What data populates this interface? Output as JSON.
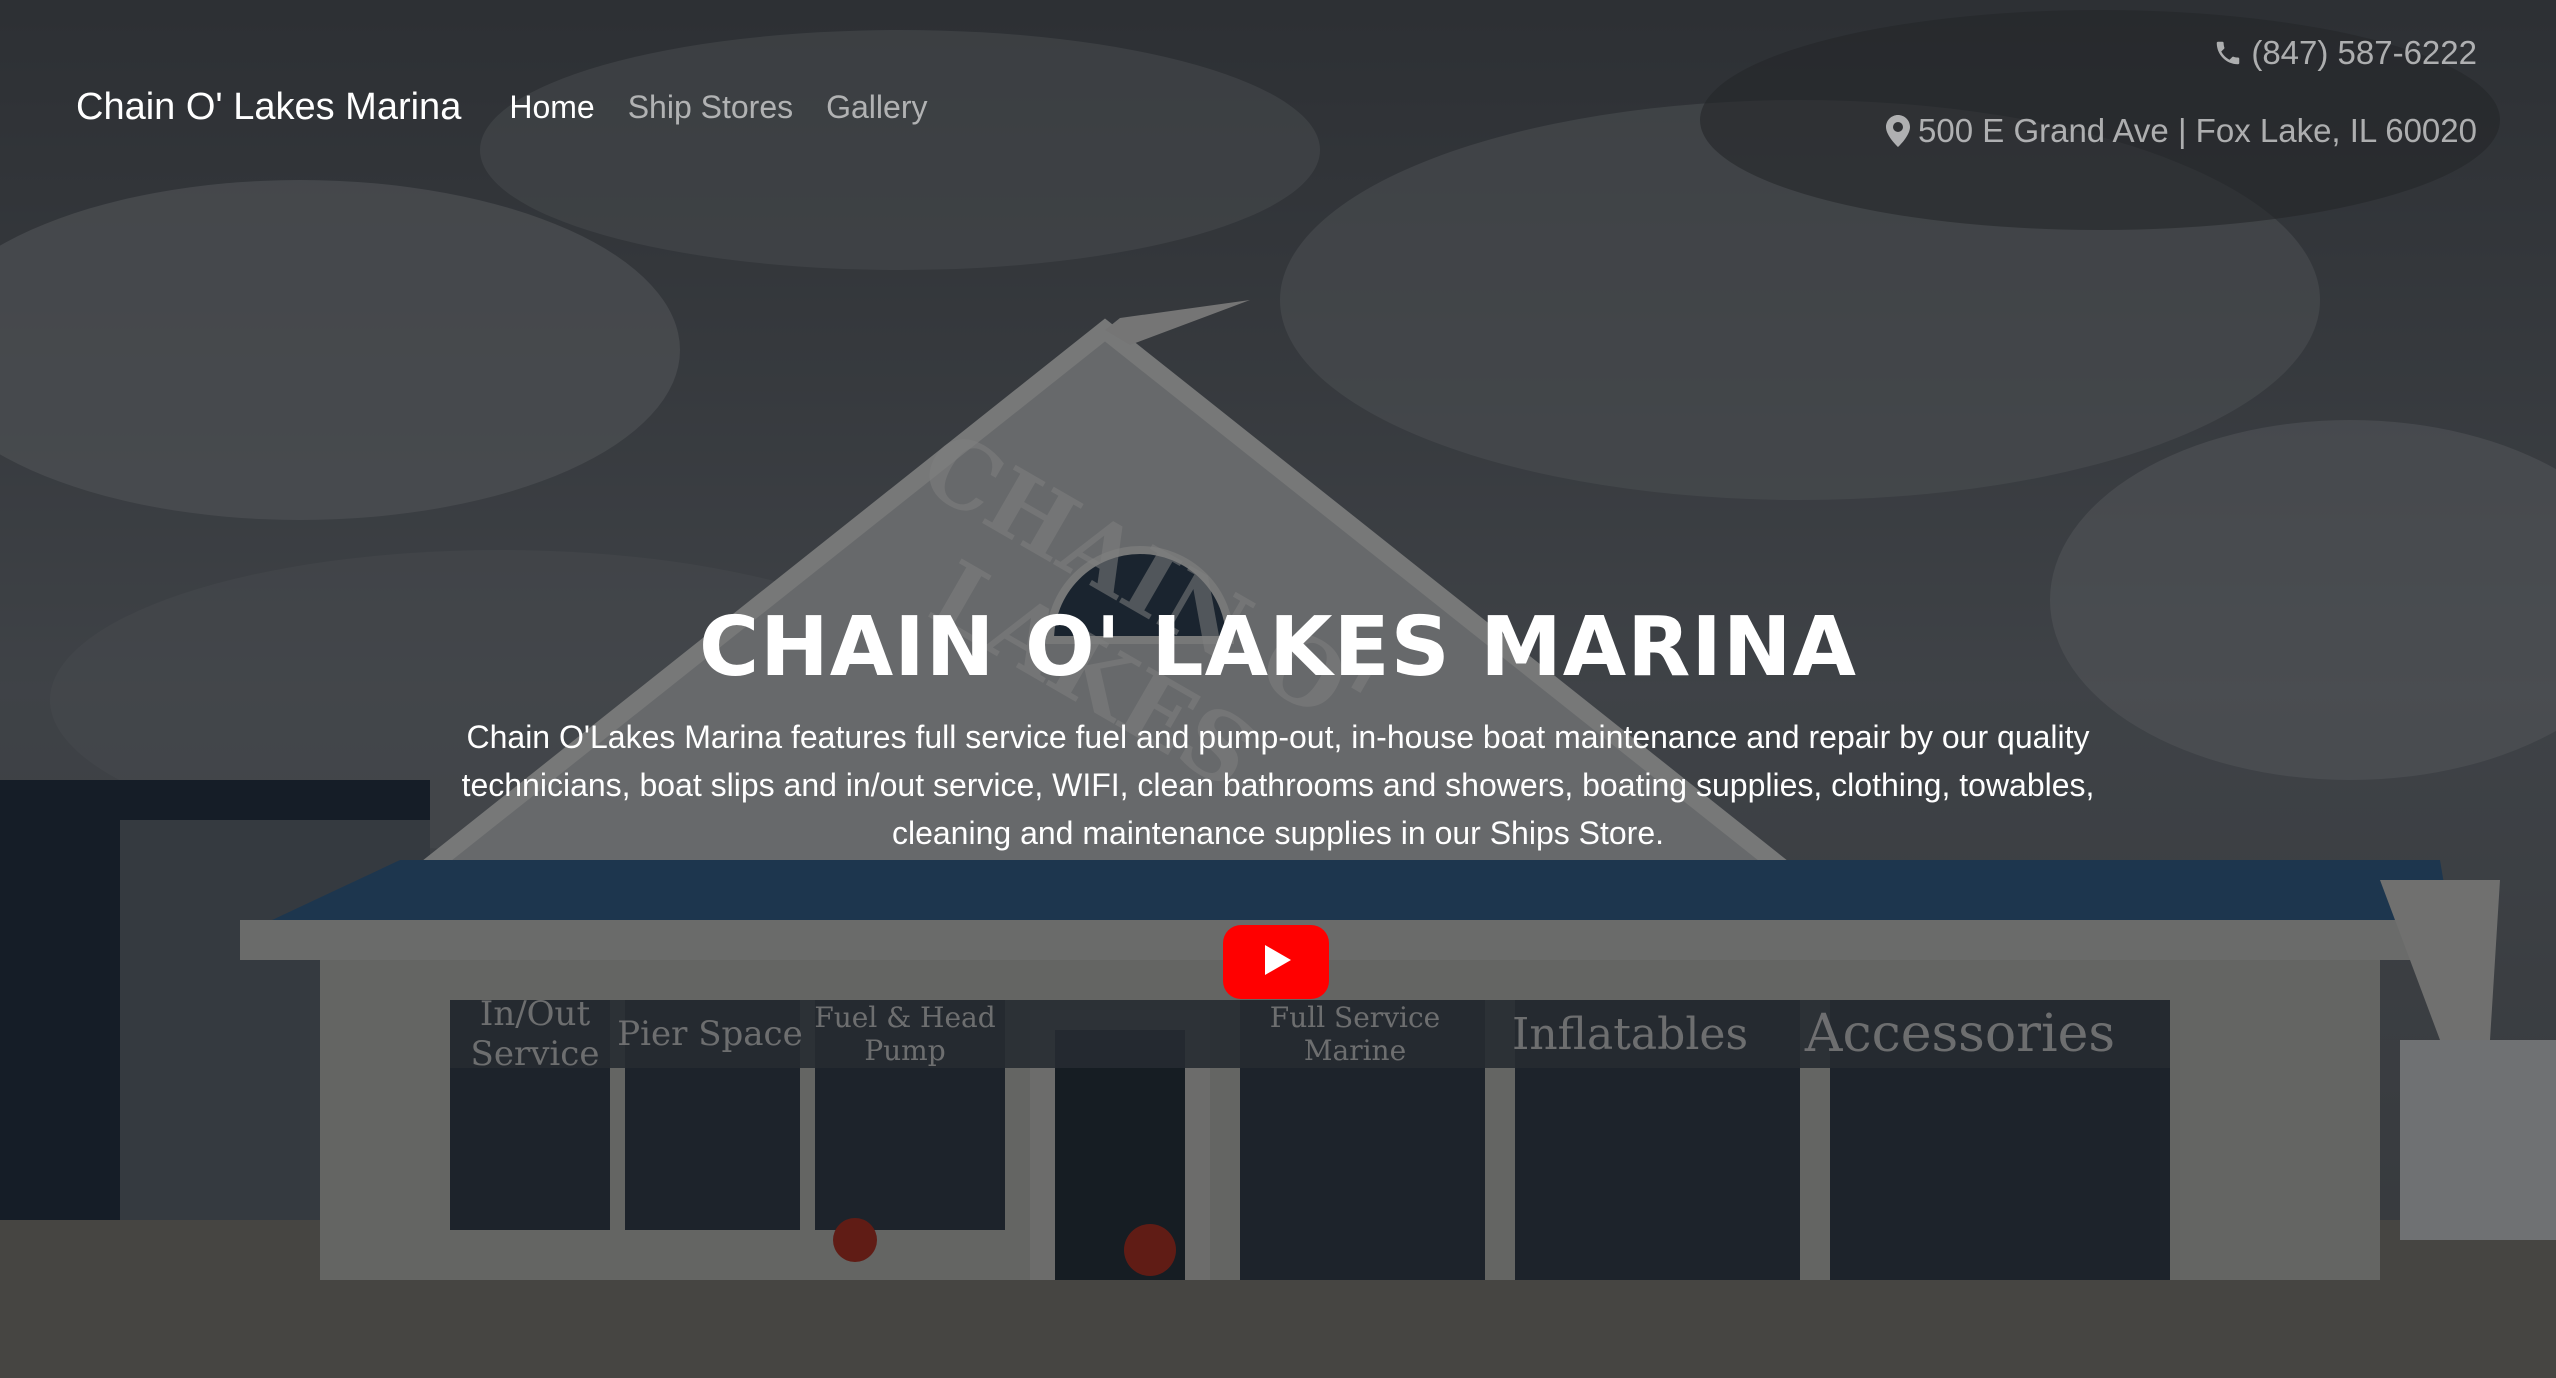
{
  "nav": {
    "brand": "Chain O' Lakes Marina",
    "links": [
      {
        "label": "Home"
      },
      {
        "label": "Ship Stores"
      },
      {
        "label": "Gallery"
      }
    ]
  },
  "contact": {
    "phone": "(847) 587-6222",
    "address": "500 E Grand Ave | Fox Lake, IL 60020"
  },
  "hero": {
    "title": "CHAIN O' LAKES MARINA",
    "description": "Chain O'Lakes Marina features full service fuel and pump-out, in-house boat maintenance and repair by our quality technicians, boat slips and in/out service, WIFI, clean bathrooms and showers, boating supplies, clothing, towables, cleaning and maintenance supplies in our Ships Store."
  },
  "storefront_signs": [
    "In/Out Service",
    "Pier Space",
    "Fuel & Head Pump",
    "Full Service Marine",
    "Inflatables",
    "Accessories"
  ],
  "building_sign": "CHAIN O' LAKES",
  "icons": {
    "phone": "phone-icon",
    "location": "map-marker-icon",
    "video": "youtube-play-icon"
  },
  "colors": {
    "youtube_red": "#ff0000",
    "text": "#ffffff"
  }
}
